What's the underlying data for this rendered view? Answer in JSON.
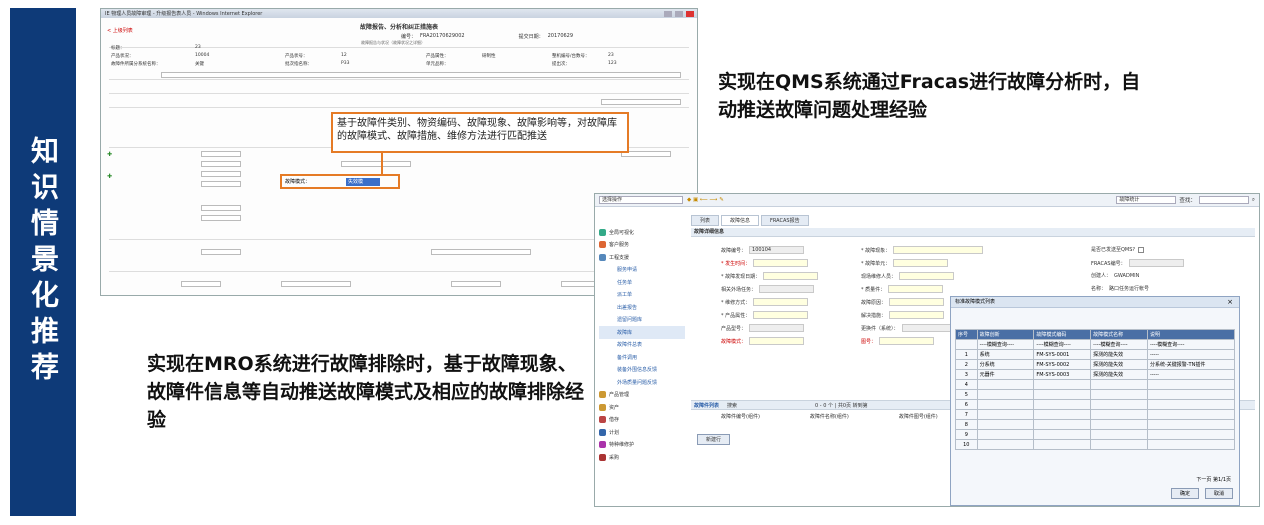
{
  "sidebar_title": "知识情景化推荐",
  "w1": {
    "window_title": "IE 物理人员故障审理 - 升级报告表人员 - Windows Internet Explorer",
    "doc_title": "故障报告、分析和纠正措施表",
    "sub_title": "故障报告与状况（故障状况之详细）",
    "back_link": "< 上级列表",
    "id_label": "编号：",
    "id_value": "FRA20170629002",
    "date_label": "提交日期：",
    "date_value": "20170629",
    "rows": [
      [
        "标题：",
        "23",
        "",
        "",
        "",
        "",
        "",
        ""
      ],
      [
        "产品状况：",
        "10004",
        "产品状号：",
        "12",
        "产品属性：",
        "研制性",
        "整机编号/台数号：",
        "23"
      ],
      [
        "故障件所属分系统名称：",
        "关键",
        "批次指名称：",
        "P33",
        "单元品称：",
        "",
        "提出次：",
        "123"
      ]
    ],
    "callout": "基于故障件类别、物资编码、故障现象、故障影响等，对故障库的故障模式、故障措施、维修方法进行匹配推送",
    "fault_mode_label": "故障模式：",
    "fault_mode_value": "失效模",
    "select_placeholder": "请选择"
  },
  "qms_text": "实现在QMS系统通过Fracas进行故障分析时，自动推送故障问题处理经验",
  "mro_text": "实现在MRO系统进行故障排除时，基于故障现象、故障件信息等自动推送故障模式及相应的故障排除经验",
  "w2": {
    "op_select": "选择操作",
    "fault_select": "故障统计",
    "search_label": "查找：",
    "tabs": [
      "列表",
      "故障信息",
      "FRACAS报告"
    ],
    "nav": [
      {
        "label": "全局可视化",
        "sub": false
      },
      {
        "label": "客户服务",
        "sub": false
      },
      {
        "label": "工程支援",
        "sub": false
      },
      {
        "label": "服务申请",
        "sub": true
      },
      {
        "label": "任务单",
        "sub": true
      },
      {
        "label": "派工单",
        "sub": true
      },
      {
        "label": "出差报告",
        "sub": true
      },
      {
        "label": "遗留问题库",
        "sub": true
      },
      {
        "label": "故障库",
        "sub": true,
        "on": true
      },
      {
        "label": "故障件总表",
        "sub": true
      },
      {
        "label": "备件调用",
        "sub": true
      },
      {
        "label": "装备外围信息反馈",
        "sub": true
      },
      {
        "label": "外场质量问题反馈",
        "sub": true
      },
      {
        "label": "产品管理",
        "sub": false
      },
      {
        "label": "资产",
        "sub": false
      },
      {
        "label": "借存",
        "sub": false
      },
      {
        "label": "计划",
        "sub": false
      },
      {
        "label": "特种维修护",
        "sub": false
      },
      {
        "label": "采购",
        "sub": false
      }
    ],
    "section_title": "故障详细信息",
    "fields": {
      "fault_no_label": "故障编号：",
      "fault_no": "100104",
      "time_label": "* 发生时间：",
      "find_date_label": "* 故障发现日期：",
      "related_label": "相关外场任务：",
      "repair_label": "* 维修方式：",
      "attr_label": "* 产品属性：",
      "model_label": "产品型号：",
      "mode_label": "故障模式：",
      "phenom_label": "* 故障现象：",
      "unit_label": "* 故障单元：",
      "person_label": "现场维修人员：",
      "qty_label": "* 质量件：",
      "cause_label": "故障原因：",
      "resolve_label": "解决措施：",
      "replace_label": "更换件（系统）：",
      "pic_label": "图号：",
      "qms_label": "是否已发送至QMS?",
      "fracas_label": "FRACAS编号：",
      "creator_label": "创建人：",
      "creator": "GWADMIN",
      "name_label": "名称：",
      "name": "路口任务运行帐号"
    },
    "list_title": "故障件列表",
    "list_search": "搜索",
    "pager": "0 - 0 个 | 共0页 转到第",
    "col1": "故障件编号(组件)",
    "col2": "故障件名称(组件)",
    "col3": "故障件图号(组件)",
    "new_btn": "新建行"
  },
  "dlg": {
    "title": "标准故障模式列表",
    "headers": [
      "序号",
      "故障创新",
      "故障模式编码",
      "故障模式名称",
      "说明"
    ],
    "filter": "----模糊查询----",
    "rows": [
      [
        "1",
        "系统",
        "FM-SYS-0001",
        "探测的能失效",
        "-----"
      ],
      [
        "2",
        "分系统",
        "FM-SYS-0002",
        "探测的能失效",
        "分系统-关键报警-TN插件"
      ],
      [
        "3",
        "元器件",
        "FM-SYS-0003",
        "探测的能失效",
        "-----"
      ],
      [
        "4",
        "",
        "",
        "",
        ""
      ],
      [
        "5",
        "",
        "",
        "",
        ""
      ],
      [
        "6",
        "",
        "",
        "",
        ""
      ],
      [
        "7",
        "",
        "",
        "",
        ""
      ],
      [
        "8",
        "",
        "",
        "",
        ""
      ],
      [
        "9",
        "",
        "",
        "",
        ""
      ],
      [
        "10",
        "",
        "",
        "",
        ""
      ]
    ],
    "pager": "下一页   第1/1页",
    "ok": "确定",
    "cancel": "取消"
  }
}
